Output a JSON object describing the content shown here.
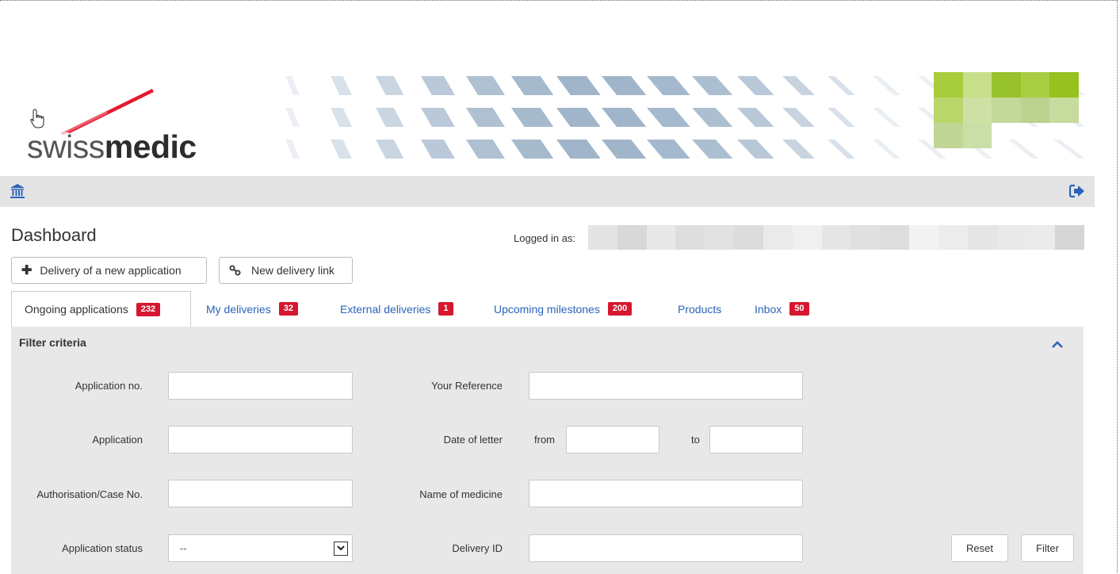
{
  "brand": {
    "logo_light": "swiss",
    "logo_bold": "medic",
    "accent_red": "#e2001a",
    "green_tiles": [
      "#a7cc3c",
      "#c8df8a",
      "#97c22b",
      "#a9cd42",
      "#96c11f",
      "#b8d66a",
      "#cfe0a5",
      "#c3d89a",
      "#bcd28e",
      "#c6db9e",
      "#c0d596",
      "#cadea7"
    ]
  },
  "toolbar": {
    "home_icon": "bank-icon",
    "logout_icon": "sign-out-icon"
  },
  "header": {
    "title": "Dashboard",
    "logged_in_label": "Logged in as:"
  },
  "actions": {
    "new_application": "Delivery of a new application",
    "new_link": "New delivery link"
  },
  "tabs": [
    {
      "label": "Ongoing applications",
      "count": "232"
    },
    {
      "label": "My deliveries",
      "count": "32"
    },
    {
      "label": "External deliveries",
      "count": "1"
    },
    {
      "label": "Upcoming milestones",
      "count": "200"
    },
    {
      "label": "Products",
      "count": ""
    },
    {
      "label": "Inbox",
      "count": "50"
    }
  ],
  "filter": {
    "title": "Filter criteria",
    "application_no": "Application no.",
    "application": "Application",
    "authorisation": "Authorisation/Case No.",
    "status": "Application status",
    "status_value": "--",
    "your_reference": "Your Reference",
    "date_of_letter": "Date of letter",
    "from": "from",
    "to": "to",
    "name_of_medicine": "Name of medicine",
    "delivery_id": "Delivery ID",
    "reset": "Reset",
    "filter": "Filter"
  }
}
